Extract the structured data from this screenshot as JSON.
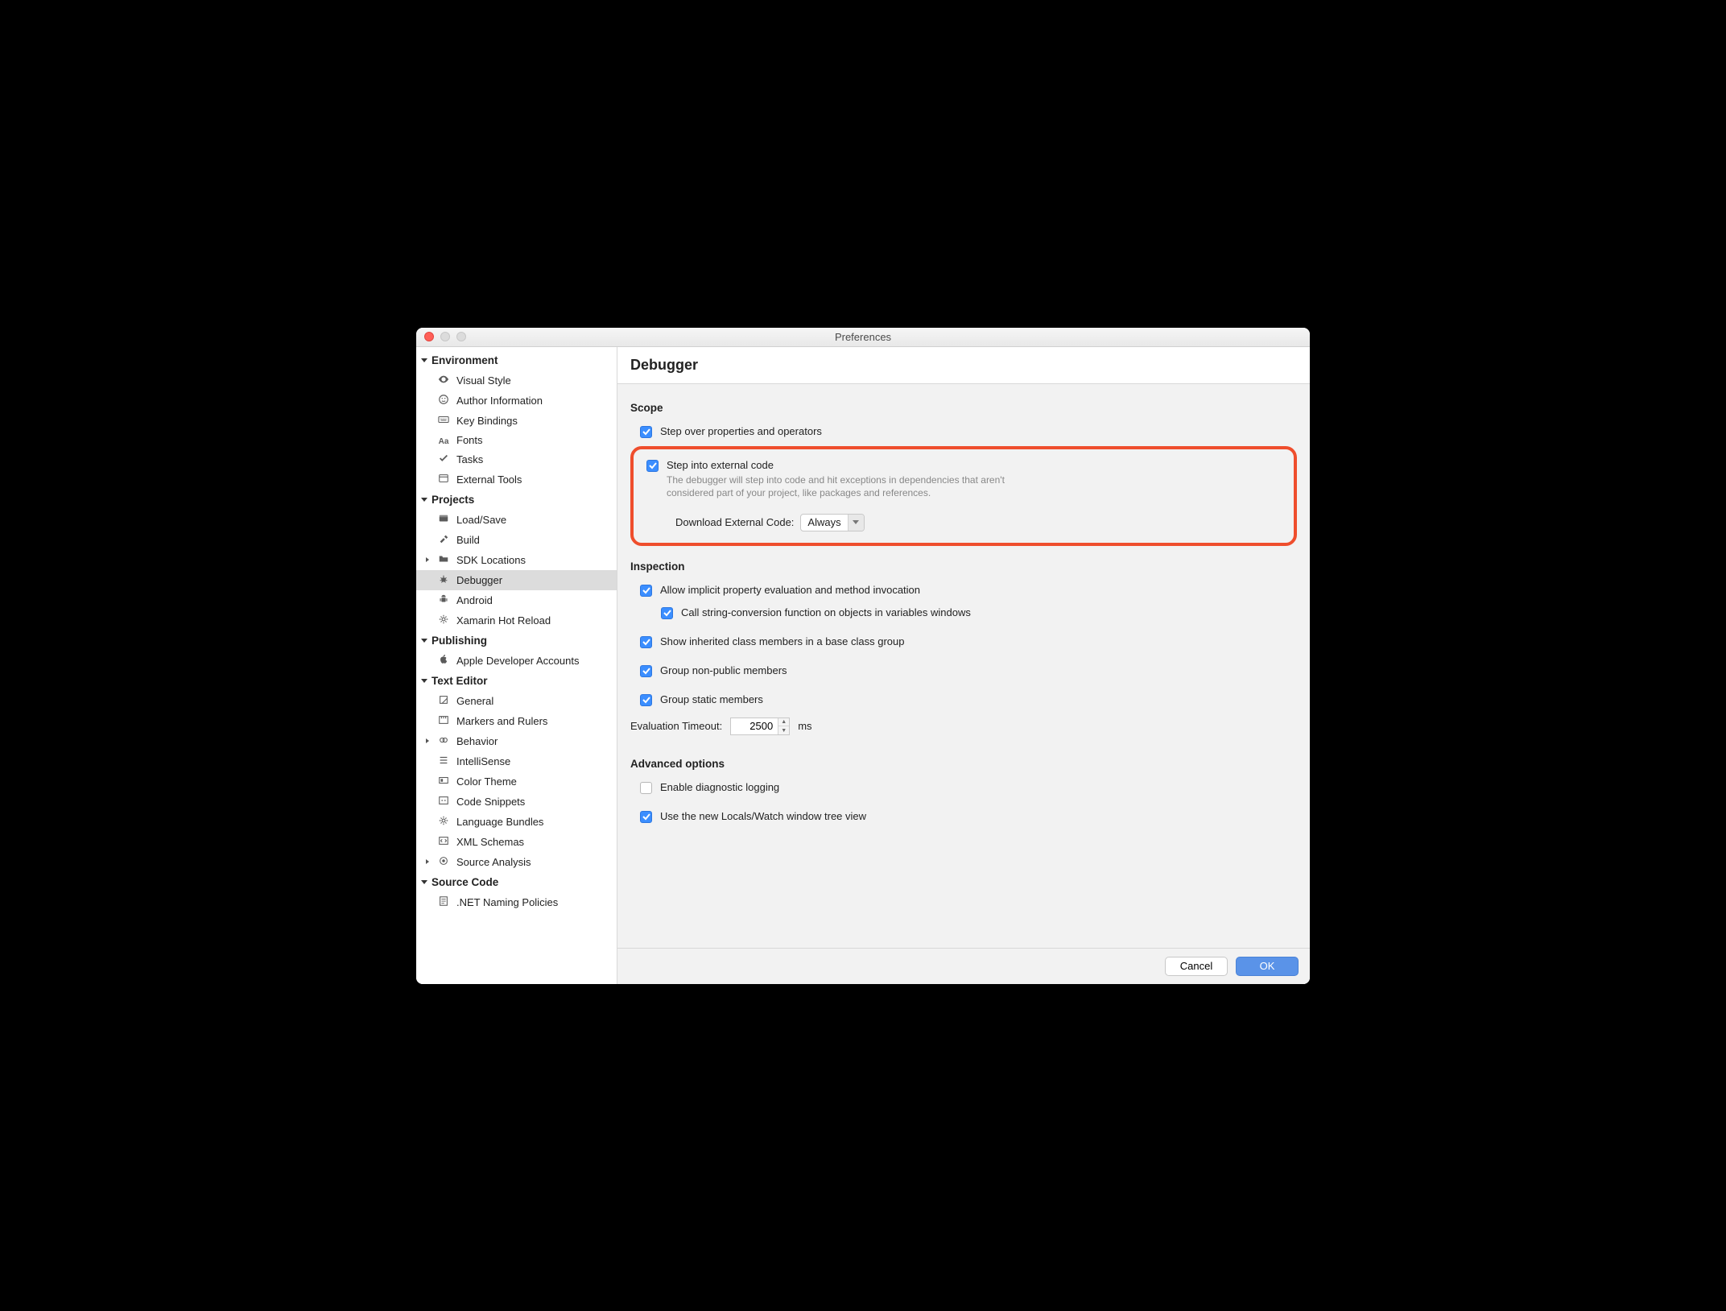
{
  "window": {
    "title": "Preferences"
  },
  "sidebar": {
    "categories": [
      {
        "label": "Environment",
        "expanded": true,
        "items": [
          {
            "icon": "eye",
            "label": "Visual Style"
          },
          {
            "icon": "smile",
            "label": "Author Information"
          },
          {
            "icon": "keyboard",
            "label": "Key Bindings"
          },
          {
            "icon": "aa",
            "label": "Fonts"
          },
          {
            "icon": "check",
            "label": "Tasks"
          },
          {
            "icon": "tools",
            "label": "External Tools"
          }
        ]
      },
      {
        "label": "Projects",
        "expanded": true,
        "items": [
          {
            "icon": "disk",
            "label": "Load/Save"
          },
          {
            "icon": "hammer",
            "label": "Build"
          },
          {
            "icon": "folder",
            "label": "SDK Locations",
            "hasChildren": true
          },
          {
            "icon": "bug",
            "label": "Debugger",
            "selected": true
          },
          {
            "icon": "android",
            "label": "Android"
          },
          {
            "icon": "gear",
            "label": "Xamarin Hot Reload"
          }
        ]
      },
      {
        "label": "Publishing",
        "expanded": true,
        "items": [
          {
            "icon": "apple",
            "label": "Apple Developer Accounts"
          }
        ]
      },
      {
        "label": "Text Editor",
        "expanded": true,
        "items": [
          {
            "icon": "edit",
            "label": "General"
          },
          {
            "icon": "ruler",
            "label": "Markers and Rulers"
          },
          {
            "icon": "behavior",
            "label": "Behavior",
            "hasChildren": true
          },
          {
            "icon": "list",
            "label": "IntelliSense"
          },
          {
            "icon": "palette",
            "label": "Color Theme"
          },
          {
            "icon": "code",
            "label": "Code Snippets"
          },
          {
            "icon": "gear",
            "label": "Language Bundles"
          },
          {
            "icon": "xml",
            "label": "XML Schemas"
          },
          {
            "icon": "target",
            "label": "Source Analysis",
            "hasChildren": true
          }
        ]
      },
      {
        "label": "Source Code",
        "expanded": true,
        "items": [
          {
            "icon": "doc",
            "label": ".NET Naming Policies"
          }
        ]
      }
    ]
  },
  "main": {
    "title": "Debugger",
    "scope": {
      "heading": "Scope",
      "step_over": {
        "label": "Step over properties and operators",
        "checked": true
      },
      "step_into": {
        "label": "Step into external code",
        "checked": true,
        "description": "The debugger will step into code and hit exceptions in dependencies that aren't considered part of your project, like packages and references.",
        "download_label": "Download External Code:",
        "download_value": "Always"
      }
    },
    "inspection": {
      "heading": "Inspection",
      "allow_implicit": {
        "label": "Allow implicit property evaluation and method invocation",
        "checked": true
      },
      "call_string": {
        "label": "Call string-conversion function on objects in variables windows",
        "checked": true
      },
      "show_inherited": {
        "label": "Show inherited class members in a base class group",
        "checked": true
      },
      "group_nonpublic": {
        "label": "Group non-public members",
        "checked": true
      },
      "group_static": {
        "label": "Group static members",
        "checked": true
      },
      "timeout_label": "Evaluation Timeout:",
      "timeout_value": "2500",
      "timeout_unit": "ms"
    },
    "advanced": {
      "heading": "Advanced options",
      "diagnostic": {
        "label": "Enable diagnostic logging",
        "checked": false
      },
      "locals_tree": {
        "label": "Use the new Locals/Watch window tree view",
        "checked": true
      }
    }
  },
  "footer": {
    "cancel": "Cancel",
    "ok": "OK"
  }
}
